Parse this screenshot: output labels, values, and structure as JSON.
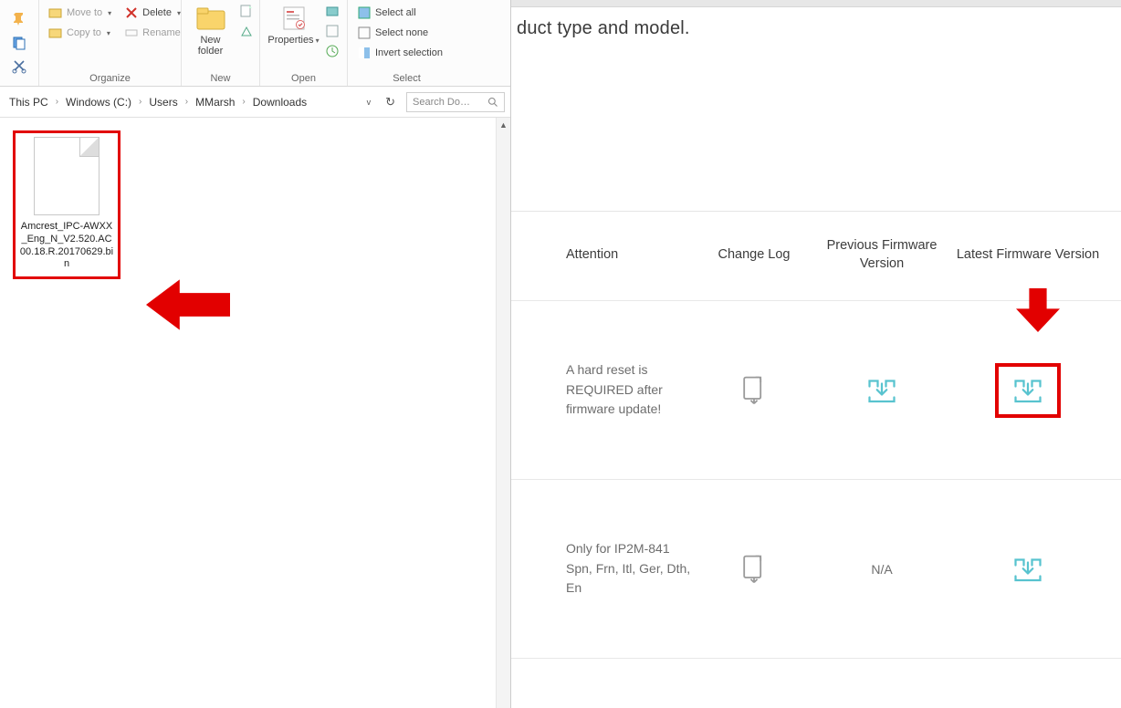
{
  "ribbon": {
    "groups": {
      "organize": {
        "label": "Organize",
        "move_to": "Move to",
        "copy_to": "Copy to",
        "delete": "Delete",
        "rename": "Rename"
      },
      "new": {
        "label": "New",
        "new_folder": "New folder"
      },
      "open": {
        "label": "Open",
        "properties": "Properties"
      },
      "select": {
        "label": "Select",
        "select_all": "Select all",
        "select_none": "Select none",
        "invert": "Invert selection"
      }
    }
  },
  "breadcrumbs": [
    "This PC",
    "Windows  (C:)",
    "Users",
    "MMarsh",
    "Downloads"
  ],
  "search_placeholder": "Search Do…",
  "file": {
    "name": "Amcrest_IPC-AWXX_Eng_N_V2.520.AC00.18.R.20170629.bin"
  },
  "web": {
    "heading_fragment": "duct type and model.",
    "columns": {
      "attention": "Attention",
      "change_log": "Change Log",
      "previous": "Previous Firmware Version",
      "latest": "Latest Firmware Version"
    },
    "rows": [
      {
        "attention": "A hard reset is REQUIRED after firmware update!",
        "previous_text": "",
        "na": ""
      },
      {
        "attention_line1": "Only for IP2M-841",
        "attention_line2": "Spn, Frn, Itl, Ger, Dth, En",
        "na": "N/A"
      }
    ]
  }
}
